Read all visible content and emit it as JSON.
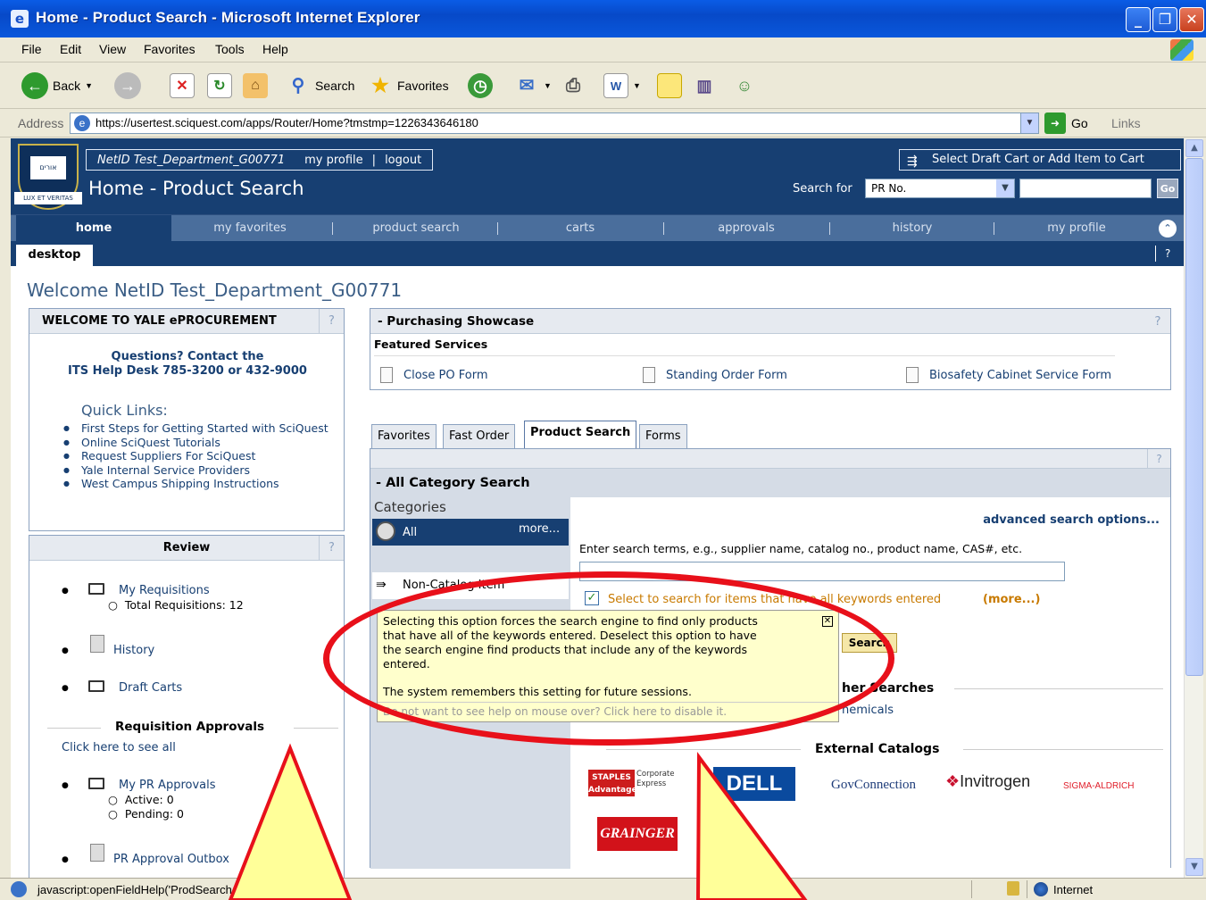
{
  "window": {
    "title": "Home - Product Search - Microsoft Internet Explorer",
    "min": "_",
    "max": "❐",
    "close": "✕"
  },
  "menu": [
    "File",
    "Edit",
    "View",
    "Favorites",
    "Tools",
    "Help"
  ],
  "toolbar": {
    "back": "Back",
    "search": "Search",
    "favorites": "Favorites"
  },
  "address": {
    "label": "Address",
    "url": "https://usertest.sciquest.com/apps/Router/Home?tmstmp=1226343646180",
    "go": "Go",
    "links": "Links"
  },
  "header": {
    "user_id": "NetID Test_Department_G00771",
    "my_profile": "my profile",
    "logout": "logout",
    "separator": "|",
    "page_title": "Home - Product Search",
    "cart_button": "Select Draft Cart or Add Item to Cart",
    "search_for_label": "Search for",
    "search_for_value": "PR No.",
    "go": "Go"
  },
  "nav": {
    "items": [
      "home",
      "my favorites",
      "product search",
      "carts",
      "approvals",
      "history",
      "my profile"
    ],
    "sub_tab": "desktop",
    "help": "?"
  },
  "welcome": "Welcome NetID Test_Department_G00771",
  "welcome_panel": {
    "title": "WELCOME TO YALE ePROCUREMENT",
    "help": "?",
    "contact_line1": "Questions? Contact the",
    "contact_line2": "ITS Help Desk 785-3200 or 432-9000",
    "quick_links_title": "Quick Links:",
    "quick_links": [
      "First Steps for Getting Started with SciQuest",
      "Online SciQuest Tutorials",
      "Request Suppliers For SciQuest",
      "Yale Internal Service Providers",
      "West Campus Shipping Instructions"
    ]
  },
  "review_panel": {
    "title": "Review",
    "help": "?",
    "my_requisitions": "My Requisitions",
    "total_requisitions": "Total Requisitions: 12",
    "history": "History",
    "draft_carts": "Draft Carts",
    "approvals_title": "Requisition Approvals",
    "click_see_all": "Click here to see all",
    "my_pr_approvals": "My PR Approvals",
    "active": "Active: 0",
    "pending": "Pending: 0",
    "pr_outbox": "PR Approval Outbox"
  },
  "showcase": {
    "title": "- Purchasing Showcase",
    "help": "?",
    "featured": "Featured Services",
    "links": [
      "Close PO Form",
      "Standing Order Form",
      "Biosafety Cabinet Service Form"
    ]
  },
  "tabs": [
    "Favorites",
    "Fast Order",
    "Product Search",
    "Forms"
  ],
  "search_area": {
    "help": "?",
    "section_title": "- All Category Search",
    "categories_label": "Categories",
    "cat_all": "All",
    "cat_more": "more...",
    "cat_noncatalog": "Non-Catalog Item",
    "advanced": "advanced search options...",
    "hint": "Enter search terms, e.g., supplier name, catalog no., product name, CAS#, etc.",
    "search_value": "",
    "checkbox_label": "Select to search for items that have all keywords entered",
    "checkbox_more": "(more...)",
    "search_button": "Search",
    "other_searches": "her Searches",
    "chemicals": "hemicals",
    "external_catalogs": "External Catalogs",
    "vendors": [
      "STAPLES Advantage",
      "Corporate Express",
      "DELL",
      "GovConnection",
      "Invitrogen",
      "SIGMA-ALDRICH",
      "GRAINGER"
    ]
  },
  "tooltip": {
    "line1": "Selecting this option forces the search engine to find only products",
    "line2": "that have all of the keywords entered. Deselect this option to have",
    "line3": "the search engine find products that include any of the keywords",
    "line4": "entered.",
    "line5": "The system remembers this setting for future sessions.",
    "footer": "Do not want to see help on mouse over? Click here to disable it."
  },
  "status": {
    "text": "javascript:openFieldHelp('ProdSearch_UseMustInc",
    "zone": "Internet"
  },
  "colors": {
    "sciquest_navy": "#173f72",
    "nav_blue": "#4a6e9c",
    "annotation_red": "#e8101a",
    "callout_yellow": "#ffff99"
  }
}
